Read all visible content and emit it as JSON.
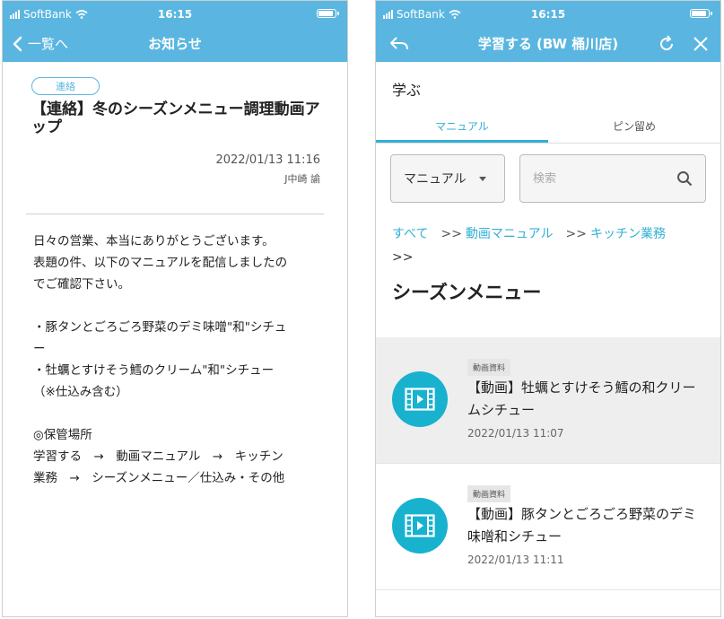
{
  "left": {
    "status": {
      "carrier": "SoftBank",
      "time": "16:15"
    },
    "nav": {
      "back_label": "一覧へ",
      "title": "お知らせ"
    },
    "notice": {
      "badge": "連絡",
      "title": "【連絡】冬のシーズンメニュー調理動画アップ",
      "datetime": "2022/01/13 11:16",
      "author": "J中崎 諭",
      "body": "日々の営業、本当にありがとうございます。\n表題の件、以下のマニュアルを配信しましたの\nでご確認下さい。\n\n・豚タンとごろごろ野菜のデミ味噌\"和\"シチュ\nー\n・牡蠣とすけそう鱈のクリーム\"和\"シチュー\n（※仕込み含む）\n\n◎保管場所\n学習する　→　動画マニュアル　→　キッチン\n業務　→　シーズンメニュー／仕込み・その他"
    }
  },
  "right": {
    "status": {
      "carrier": "SoftBank",
      "time": "16:15"
    },
    "nav": {
      "title": "学習する (BW 桶川店)"
    },
    "heading": "学ぶ",
    "tabs": [
      {
        "label": "マニュアル"
      },
      {
        "label": "ピン留め"
      }
    ],
    "filter": {
      "selected": "マニュアル",
      "search_placeholder": "検索"
    },
    "breadcrumb": {
      "items": [
        "すべて",
        "動画マニュアル",
        "キッチン業務"
      ],
      "separator": ">>"
    },
    "section_title": "シーズンメニュー",
    "items": [
      {
        "tag": "動画資料",
        "title": "【動画】牡蠣とすけそう鱈の和クリームシチュー",
        "date": "2022/01/13 11:07"
      },
      {
        "tag": "動画資料",
        "title": "【動画】豚タンとごろごろ野菜のデミ味噌和シチュー",
        "date": "2022/01/13 11:11"
      }
    ]
  },
  "icons": {
    "signal": "signal-icon",
    "wifi": "wifi-icon",
    "battery": "battery-icon",
    "back": "chevron-left-icon",
    "return": "return-arrow-icon",
    "refresh": "refresh-icon",
    "close": "close-icon",
    "search": "search-icon",
    "video": "video-icon"
  },
  "colors": {
    "header": "#5ab6e0",
    "accent": "#31b0d5",
    "video_circle": "#18b2cf"
  }
}
